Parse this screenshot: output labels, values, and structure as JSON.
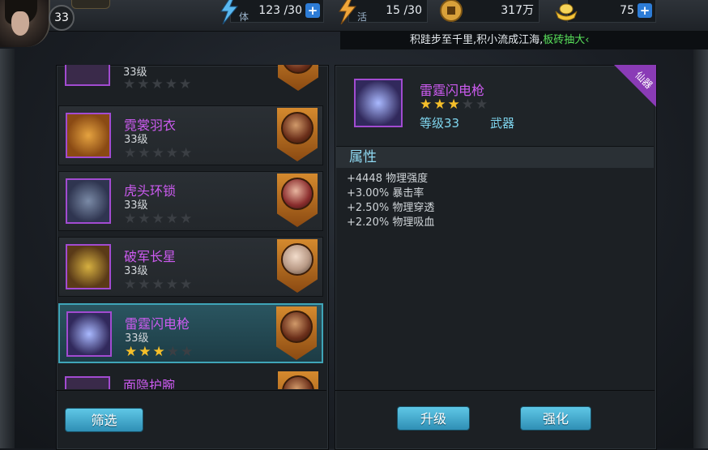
{
  "player": {
    "level": "33"
  },
  "resources": {
    "stamina": {
      "label": "体",
      "value": "123 /30"
    },
    "vitality": {
      "label": "活",
      "value": "15 /30"
    },
    "coins": {
      "value": "317万"
    },
    "ingots": {
      "value": "75"
    }
  },
  "ticker": {
    "text": "积跬步至千里,积小流成江海,",
    "highlight": "板砖抽大‹"
  },
  "equipment_list": [
    {
      "name": "",
      "level": "33级",
      "stars_on": 0,
      "stars_total": 5,
      "thumb": "cloth"
    },
    {
      "name": "霓裳羽衣",
      "level": "33级",
      "stars_on": 0,
      "stars_total": 5,
      "thumb": "gold"
    },
    {
      "name": "虎头环锁",
      "level": "33级",
      "stars_on": 0,
      "stars_total": 5,
      "thumb": "armor"
    },
    {
      "name": "破军长星",
      "level": "33级",
      "stars_on": 0,
      "stars_total": 5,
      "thumb": "mace"
    },
    {
      "name": "雷霆闪电枪",
      "level": "33级",
      "stars_on": 3,
      "stars_total": 5,
      "thumb": "spear",
      "selected": true
    },
    {
      "name": "面隐护腕",
      "level": "",
      "stars_on": 0,
      "stars_total": 5,
      "thumb": "cloth"
    }
  ],
  "detail": {
    "name": "雷霆闪电枪",
    "stars_on": 3,
    "stars_total": 5,
    "level": "等级33",
    "type": "武器",
    "tag": "仙器",
    "attr_header": "属性",
    "attributes": [
      "+4448 物理强度",
      "+3.00% 暴击率",
      "+2.50% 物理穿透",
      "+2.20% 物理吸血"
    ]
  },
  "buttons": {
    "filter": "筛选",
    "upgrade": "升级",
    "enhance": "强化"
  },
  "colors": {
    "rare_name": "#cc5bf0",
    "star_on": "#f6bf2a",
    "button": "#3fa5c8",
    "accent": "#7fd6ef"
  },
  "icons": [
    "stamina-lightning-icon",
    "vitality-lightning-icon",
    "coin-icon",
    "ingot-icon",
    "plus-icon"
  ]
}
